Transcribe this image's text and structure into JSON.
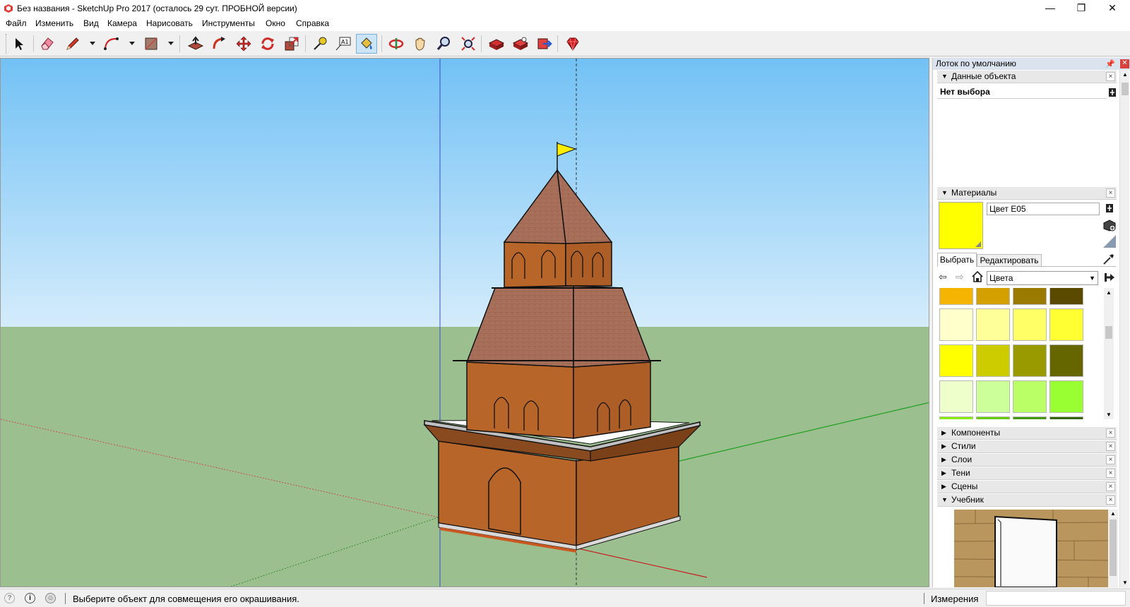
{
  "window": {
    "title": "Без названия - SketchUp Pro 2017 (осталось 29 сут. ПРОБНОЙ версии)",
    "minimize": "—",
    "restore": "❐",
    "close": "✕"
  },
  "menu": [
    "Файл",
    "Изменить",
    "Вид",
    "Камера",
    "Нарисовать",
    "Инструменты",
    "Окно",
    "Справка"
  ],
  "toolbar": {
    "icons": [
      "select-icon",
      "eraser-icon",
      "pencil-icon",
      "arc-icon",
      "rectangle-icon",
      "push-pull-icon",
      "follow-me-icon",
      "move-icon",
      "rotate-icon",
      "scale-icon",
      "tape-measure-icon",
      "text-icon",
      "paint-bucket-icon",
      "orbit-icon",
      "pan-icon",
      "zoom-icon",
      "zoom-extents-icon",
      "warehouse-icon",
      "extension-warehouse-icon",
      "send-to-layout-icon",
      "ruby-icon"
    ],
    "active_tool": "paint-bucket-icon"
  },
  "tray": {
    "title": "Лоток по умолчанию",
    "entity_info": {
      "header": "Данные объекта",
      "selection": "Нет выбора"
    },
    "materials": {
      "header": "Материалы",
      "current_name": "Цвет E05",
      "current_color": "#ffff00",
      "tab_select": "Выбрать",
      "tab_edit": "Редактировать",
      "library": "Цвета",
      "swatches": [
        "#f5b400",
        "#d4a000",
        "#9a7a00",
        "#5a4a00",
        "#ffffcc",
        "#ffff99",
        "#ffff66",
        "#ffff33",
        "#ffff00",
        "#cccc00",
        "#999900",
        "#666600",
        "#eeffcc",
        "#ccff99",
        "#bbff66",
        "#99ff33",
        "#88ee00",
        "#66cc00",
        "#449900",
        "#336600"
      ]
    },
    "collapsed_panels": [
      "Компоненты",
      "Стили",
      "Слои",
      "Тени",
      "Сцены"
    ],
    "instructor": {
      "header": "Учебник"
    }
  },
  "status": {
    "message": "Выберите объект для совмещения его окрашивания.",
    "measurements_label": "Измерения",
    "measurements_value": ""
  },
  "colors": {
    "sky_top": "#72c1f5",
    "sky_bottom": "#d4ecfb",
    "ground": "#9cbf8f",
    "brick": "#b8652a",
    "roof": "#a8705a",
    "flag": "#ffee00"
  }
}
